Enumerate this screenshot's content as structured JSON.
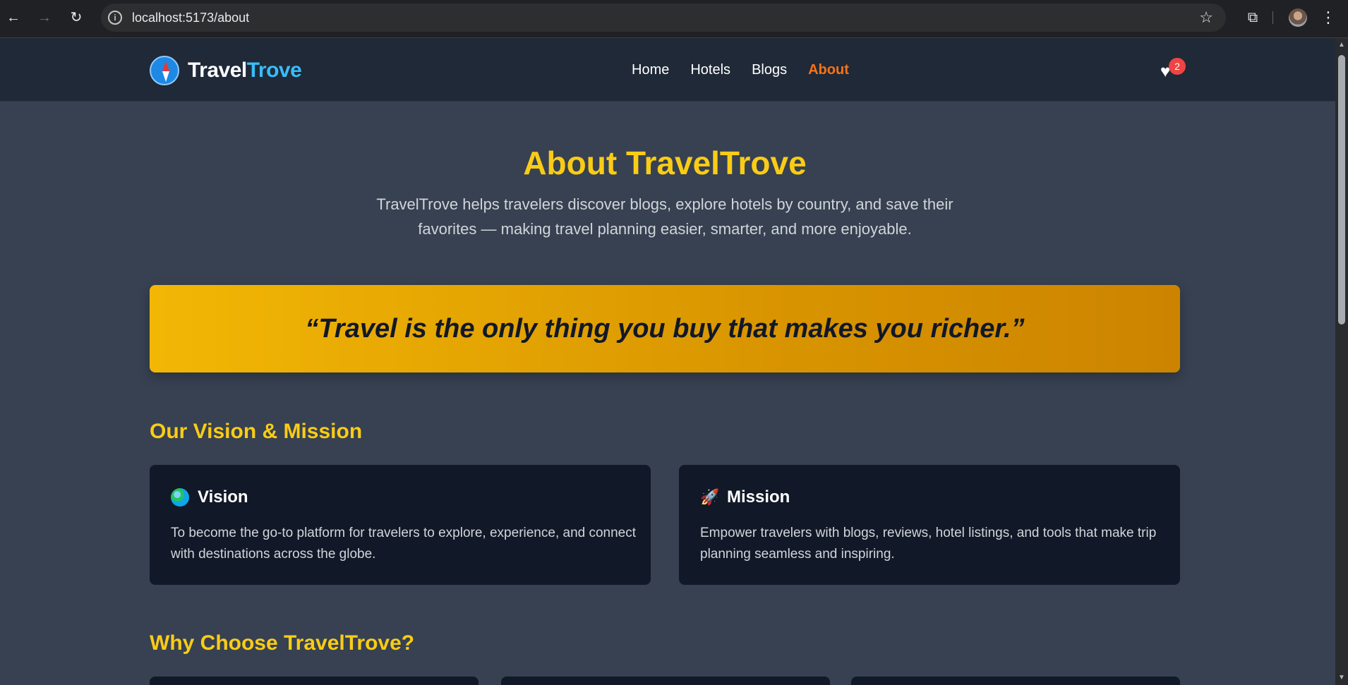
{
  "browser": {
    "url": "localhost:5173/about"
  },
  "site": {
    "logo": {
      "part1": "Travel",
      "part2": "Trove"
    },
    "nav": [
      "Home",
      "Hotels",
      "Blogs",
      "About"
    ],
    "active_nav": "About",
    "favorites_count": "2"
  },
  "hero": {
    "title": "About TravelTrove",
    "subtitle": "TravelTrove helps travelers discover blogs, explore hotels by country, and save their favorites — making travel planning easier, smarter, and more enjoyable."
  },
  "quote": "“Travel is the only thing you buy that makes you richer.”",
  "vision_mission": {
    "heading": "Our Vision & Mission",
    "vision": {
      "icon": "globe-icon",
      "title": "Vision",
      "text": "To become the go-to platform for travelers to explore, experience, and connect with destinations across the globe."
    },
    "mission": {
      "icon": "rocket-icon",
      "title": "Mission",
      "text": "Empower travelers with blogs, reviews, hotel listings, and tools that make trip planning seamless and inspiring."
    }
  },
  "why": {
    "heading": "Why Choose TravelTrove?"
  },
  "colors": {
    "accent_yellow": "#facc15",
    "active_nav": "#f97316",
    "logo_blue": "#38bdf8",
    "badge_red": "#ef4444"
  }
}
